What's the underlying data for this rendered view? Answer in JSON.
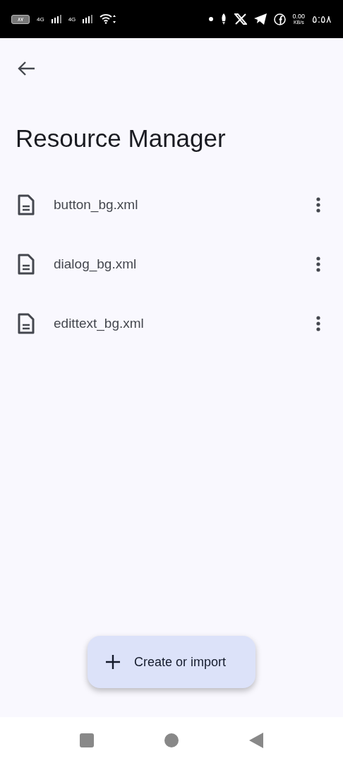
{
  "status_bar": {
    "battery": "٨٧",
    "sim_1": "4G",
    "sim_2": "4G",
    "net_speed": "0.00",
    "net_unit": "KB/s",
    "time": "٥:٥٨"
  },
  "app_bar": {
    "title": "Resource Manager"
  },
  "files": [
    {
      "name": "button_bg.xml"
    },
    {
      "name": "dialog_bg.xml"
    },
    {
      "name": "edittext_bg.xml"
    }
  ],
  "fab": {
    "label": "Create or import"
  }
}
